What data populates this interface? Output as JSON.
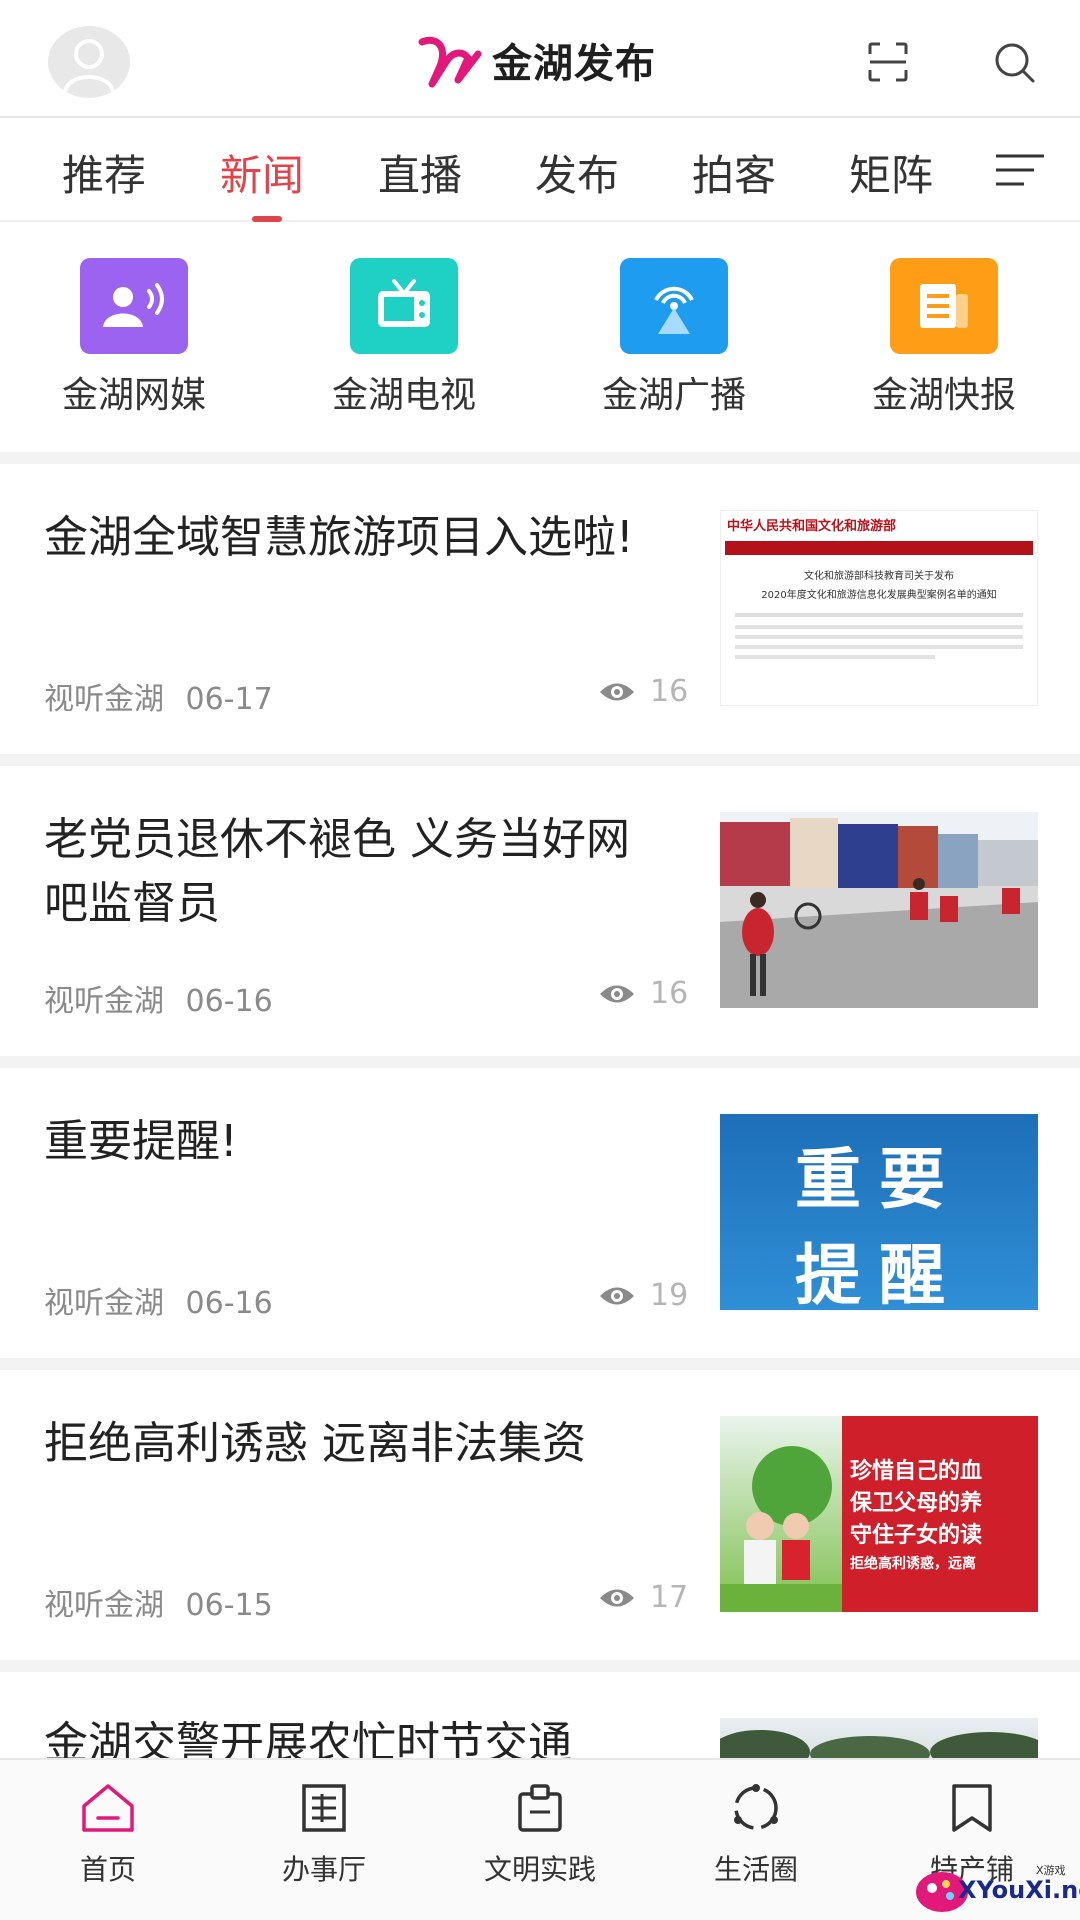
{
  "header": {
    "app_name": "金湖发布",
    "brand_color": "#e2187a",
    "icons": [
      "avatar-icon",
      "scan-icon",
      "search-icon"
    ]
  },
  "tabs": [
    {
      "label": "推荐",
      "active": false
    },
    {
      "label": "新闻",
      "active": true
    },
    {
      "label": "直播",
      "active": false
    },
    {
      "label": "发布",
      "active": false
    },
    {
      "label": "拍客",
      "active": false
    },
    {
      "label": "矩阵",
      "active": false
    }
  ],
  "accent_color": "#e2434a",
  "quick_entries": [
    {
      "label": "金湖网媒",
      "icon": "broadcast-person-icon",
      "color": "#9b63f0"
    },
    {
      "label": "金湖电视",
      "icon": "tv-icon",
      "color": "#1fd1c4"
    },
    {
      "label": "金湖广播",
      "icon": "radio-tower-icon",
      "color": "#1e9cf0"
    },
    {
      "label": "金湖快报",
      "icon": "newspaper-icon",
      "color": "#ff9e16"
    }
  ],
  "news": [
    {
      "title": "金湖全域智慧旅游项目入选啦!",
      "source": "视听金湖",
      "date": "06-17",
      "views": "16",
      "thumb": {
        "heading": "中华人民共和国文化和旅游部",
        "line1": "文化和旅游部科技教育司关于发布",
        "line2": "2020年度文化和旅游信息化发展典型案例名单的通知"
      }
    },
    {
      "title": "老党员退休不褪色 义务当好网吧监督员",
      "source": "视听金湖",
      "date": "06-16",
      "views": "16",
      "thumb": {}
    },
    {
      "title": "重要提醒!",
      "source": "视听金湖",
      "date": "06-16",
      "views": "19",
      "thumb": {
        "line1": "重要",
        "line2": "提醒"
      }
    },
    {
      "title": "拒绝高利诱惑 远离非法集资",
      "source": "视听金湖",
      "date": "06-15",
      "views": "17",
      "thumb": {
        "line1": "珍惜自己的血",
        "line2": "保卫父母的养",
        "line3": "守住子女的读",
        "line4": "拒绝高利诱惑，远离"
      }
    },
    {
      "title": "金湖交警开展农忙时节交通",
      "source": "",
      "date": "",
      "views": "",
      "thumb": {}
    }
  ],
  "bottom_nav": [
    {
      "label": "首页",
      "icon": "home-icon",
      "active": true
    },
    {
      "label": "办事厅",
      "icon": "document-icon",
      "active": false
    },
    {
      "label": "文明实践",
      "icon": "clipboard-icon",
      "active": false
    },
    {
      "label": "生活圈",
      "icon": "circle-nodes-icon",
      "active": false
    },
    {
      "label": "特产铺",
      "icon": "bookmark-icon",
      "active": false
    }
  ],
  "watermark": {
    "text": "XYouXi.net",
    "small": "X游戏"
  }
}
